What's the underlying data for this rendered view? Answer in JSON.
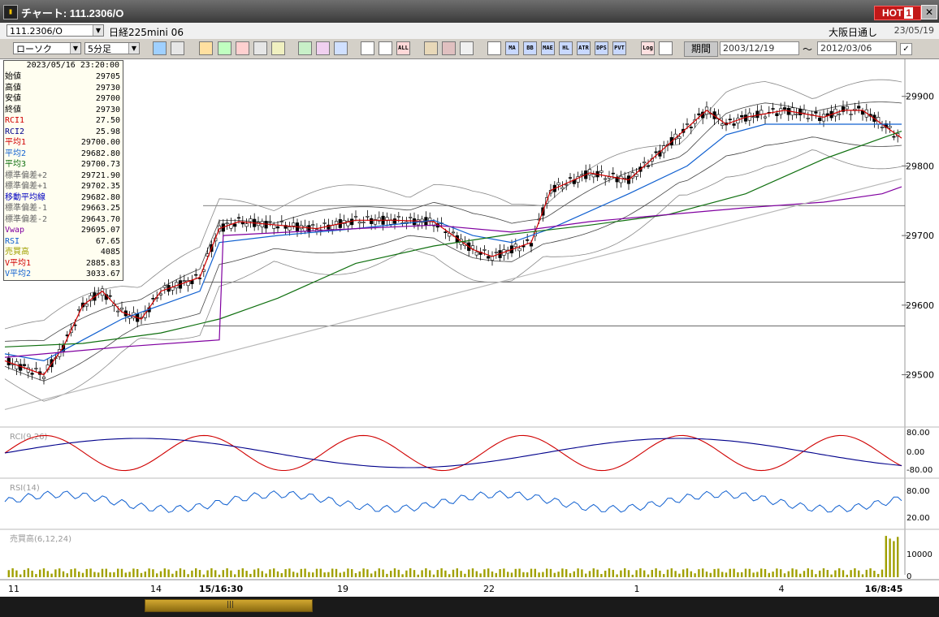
{
  "window": {
    "title": "チャート: 111.2306/O",
    "hot_label": "HOT",
    "hot_num": "1",
    "close": "✕",
    "app_icon": "chart-icon"
  },
  "infobar": {
    "code": "111.2306/O",
    "instrument": "日経225mini 06",
    "market": "大阪日通し",
    "date": "23/05/19"
  },
  "toolbar": {
    "chart_type": "ローソク",
    "interval": "5分足",
    "period_label": "期間",
    "date_from": "2003/12/19",
    "separator": "〜",
    "date_to": "2012/03/06",
    "buttons": [
      "search",
      "crosshair",
      "draw",
      "zoom",
      "bar",
      "split",
      "warn",
      "line",
      "cursor",
      "refresh",
      "candle",
      "candle2",
      "ALL",
      "wrench",
      "tool",
      "color",
      "grid",
      "MA",
      "BB",
      "MAE",
      "HL",
      "ATR",
      "DPS",
      "PVT",
      "Log",
      "exit"
    ]
  },
  "info_panel": {
    "datetime": "2023/05/16  23:20:00",
    "rows": [
      {
        "label": "始値",
        "value": "29705",
        "color": "#000000"
      },
      {
        "label": "高値",
        "value": "29730",
        "color": "#000000"
      },
      {
        "label": "安値",
        "value": "29700",
        "color": "#000000"
      },
      {
        "label": "終値",
        "value": "29730",
        "color": "#000000"
      },
      {
        "label": "RCI1",
        "value": "27.50",
        "color": "#d00000"
      },
      {
        "label": "RCI2",
        "value": "25.98",
        "color": "#00008b"
      },
      {
        "label": "平均1",
        "value": "29700.00",
        "color": "#d00000"
      },
      {
        "label": "平均2",
        "value": "29682.80",
        "color": "#1060d0"
      },
      {
        "label": "平均3",
        "value": "29700.73",
        "color": "#107010"
      },
      {
        "label": "標準偏差+2",
        "value": "29721.90",
        "color": "#666666"
      },
      {
        "label": "標準偏差+1",
        "value": "29702.35",
        "color": "#666666"
      },
      {
        "label": "移動平均線",
        "value": "29682.80",
        "color": "#0000c0"
      },
      {
        "label": "標準偏差-1",
        "value": "29663.25",
        "color": "#666666"
      },
      {
        "label": "標準偏差-2",
        "value": "29643.70",
        "color": "#666666"
      },
      {
        "label": "Vwap",
        "value": "29695.07",
        "color": "#8000a0"
      },
      {
        "label": "RSI",
        "value": "67.65",
        "color": "#1060d0"
      },
      {
        "label": "売買高",
        "value": "4085",
        "color": "#a0a000"
      },
      {
        "label": "V平均1",
        "value": "2885.83",
        "color": "#d00000"
      },
      {
        "label": "V平均2",
        "value": "3033.67",
        "color": "#1060d0"
      }
    ]
  },
  "chart_data": {
    "type": "line",
    "price_axis": {
      "ticks": [
        29500,
        29600,
        29700,
        29800,
        29900
      ],
      "range": [
        29440,
        29930
      ]
    },
    "x_ticks": [
      "11",
      "14",
      "15/16:30",
      "19",
      "22",
      "1",
      "4",
      "16/8:45"
    ],
    "series": [
      {
        "name": "平均1",
        "color": "#d00000",
        "points": [
          [
            0,
            29520
          ],
          [
            5,
            29510
          ],
          [
            10,
            29500
          ],
          [
            15,
            29540
          ],
          [
            20,
            29600
          ],
          [
            25,
            29620
          ],
          [
            30,
            29590
          ],
          [
            35,
            29580
          ],
          [
            40,
            29620
          ],
          [
            45,
            29630
          ],
          [
            50,
            29640
          ],
          [
            55,
            29710
          ],
          [
            60,
            29720
          ],
          [
            70,
            29715
          ],
          [
            80,
            29710
          ],
          [
            90,
            29722
          ],
          [
            100,
            29722
          ],
          [
            110,
            29720
          ],
          [
            115,
            29700
          ],
          [
            120,
            29680
          ],
          [
            125,
            29670
          ],
          [
            130,
            29680
          ],
          [
            135,
            29690
          ],
          [
            140,
            29765
          ],
          [
            150,
            29790
          ],
          [
            160,
            29780
          ],
          [
            170,
            29830
          ],
          [
            180,
            29880
          ],
          [
            185,
            29860
          ],
          [
            190,
            29870
          ],
          [
            200,
            29880
          ],
          [
            210,
            29870
          ],
          [
            215,
            29880
          ],
          [
            220,
            29880
          ],
          [
            225,
            29860
          ],
          [
            230,
            29840
          ]
        ]
      },
      {
        "name": "平均2",
        "color": "#1060d0",
        "points": [
          [
            0,
            29530
          ],
          [
            10,
            29520
          ],
          [
            20,
            29550
          ],
          [
            30,
            29580
          ],
          [
            40,
            29600
          ],
          [
            50,
            29620
          ],
          [
            55,
            29690
          ],
          [
            70,
            29700
          ],
          [
            90,
            29710
          ],
          [
            110,
            29722
          ],
          [
            120,
            29700
          ],
          [
            130,
            29690
          ],
          [
            140,
            29710
          ],
          [
            160,
            29760
          ],
          [
            175,
            29800
          ],
          [
            185,
            29845
          ],
          [
            195,
            29860
          ],
          [
            210,
            29860
          ],
          [
            220,
            29860
          ],
          [
            230,
            29860
          ]
        ]
      },
      {
        "name": "平均3",
        "color": "#107010",
        "points": [
          [
            0,
            29540
          ],
          [
            20,
            29545
          ],
          [
            40,
            29560
          ],
          [
            55,
            29580
          ],
          [
            70,
            29610
          ],
          [
            90,
            29660
          ],
          [
            110,
            29685
          ],
          [
            130,
            29702
          ],
          [
            150,
            29715
          ],
          [
            170,
            29730
          ],
          [
            190,
            29760
          ],
          [
            210,
            29810
          ],
          [
            225,
            29840
          ],
          [
            230,
            29850
          ]
        ]
      },
      {
        "name": "Vwap",
        "color": "#8000a0",
        "points": [
          [
            0,
            29525
          ],
          [
            30,
            29540
          ],
          [
            55,
            29550
          ],
          [
            56,
            29700
          ],
          [
            90,
            29710
          ],
          [
            110,
            29715
          ],
          [
            130,
            29705
          ],
          [
            150,
            29720
          ],
          [
            170,
            29730
          ],
          [
            190,
            29740
          ],
          [
            210,
            29748
          ],
          [
            225,
            29760
          ],
          [
            230,
            29770
          ]
        ]
      },
      {
        "name": "trend",
        "color": "#b8b8b8",
        "points": [
          [
            0,
            29450
          ],
          [
            230,
            29782
          ]
        ]
      }
    ],
    "horizontal_lines": [
      29743,
      29633,
      29570
    ],
    "rci_axis": [
      "80.00",
      "0.00",
      "-80.00"
    ],
    "rci_label": "RCI(9,26)",
    "rsi_axis": [
      "80.00",
      "20.00"
    ],
    "rsi_label": "RSI(14)",
    "volume_axis": [
      "10000",
      "0"
    ],
    "volume_label": "売買高(6,12,24)"
  },
  "scrollbar": {
    "grip": "|||"
  }
}
